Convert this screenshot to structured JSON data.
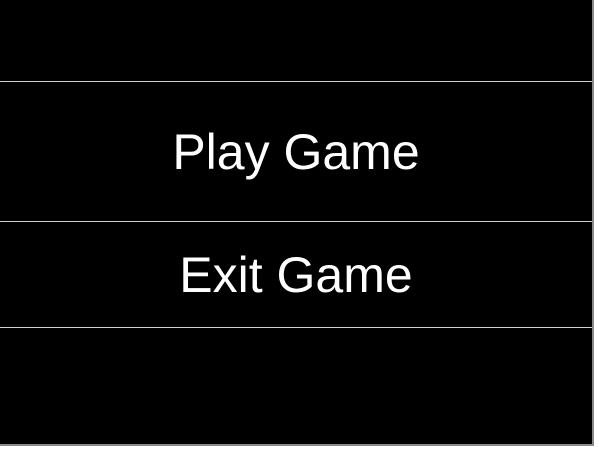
{
  "menu": {
    "play_label": "Play Game",
    "exit_label": "Exit Game"
  },
  "colors": {
    "background": "#000000",
    "text": "#ffffff",
    "divider": "#cfcfcf"
  }
}
